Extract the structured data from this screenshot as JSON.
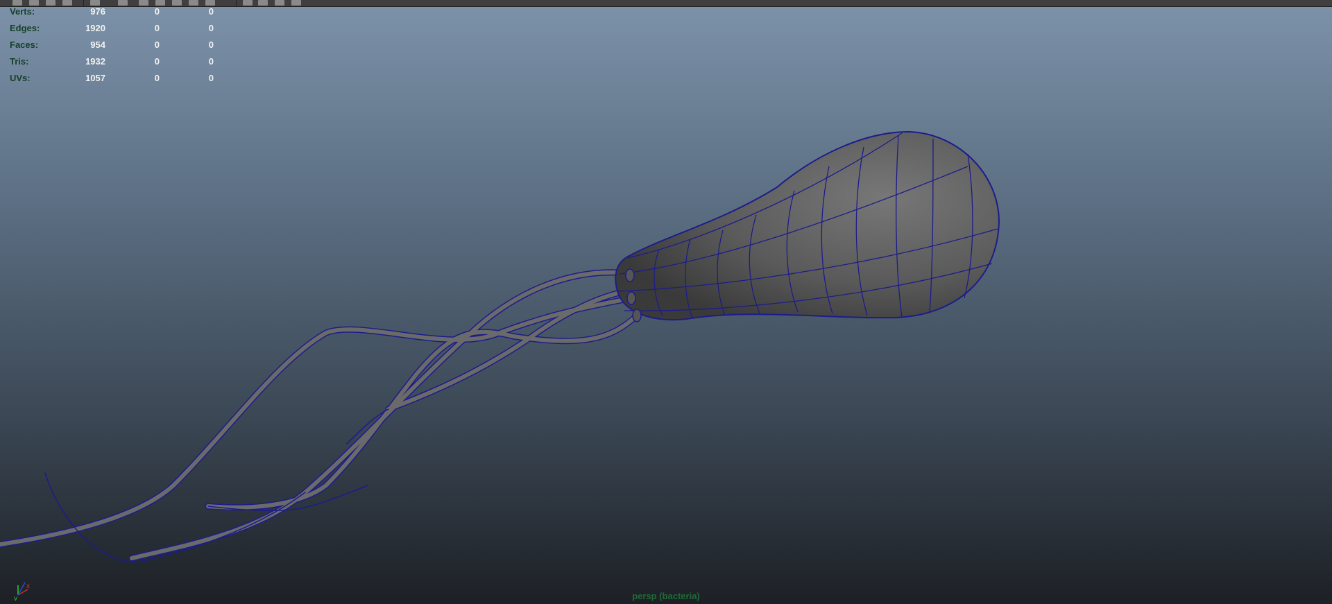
{
  "toolbar": {
    "icons": [
      "select-icon",
      "lasso-icon",
      "camera-icon",
      "grid-icon",
      "wireframe-icon",
      "shaded-icon",
      "texture-icon",
      "light-icon",
      "shadow-icon",
      "isolate-icon",
      "xray-icon",
      "resolution-gate-icon",
      "film-gate-icon",
      "safe-action-icon",
      "heads-up-icon"
    ]
  },
  "hud": {
    "rows": [
      {
        "label": "Verts:",
        "values": [
          "976",
          "0",
          "0"
        ]
      },
      {
        "label": "Edges:",
        "values": [
          "1920",
          "0",
          "0"
        ]
      },
      {
        "label": "Faces:",
        "values": [
          "954",
          "0",
          "0"
        ]
      },
      {
        "label": "Tris:",
        "values": [
          "1932",
          "0",
          "0"
        ]
      },
      {
        "label": "UVs:",
        "values": [
          "1057",
          "0",
          "0"
        ]
      }
    ]
  },
  "camera": {
    "label": "persp (bacteria)"
  },
  "axis": {
    "x_label": "x",
    "y_label": "y"
  },
  "colors": {
    "wire": "#1c1c8c",
    "mesh": "#5a5a5a",
    "hud_label": "#163f2a",
    "hud_value": "#f2f2f2",
    "camera_label": "#1f6b35"
  }
}
